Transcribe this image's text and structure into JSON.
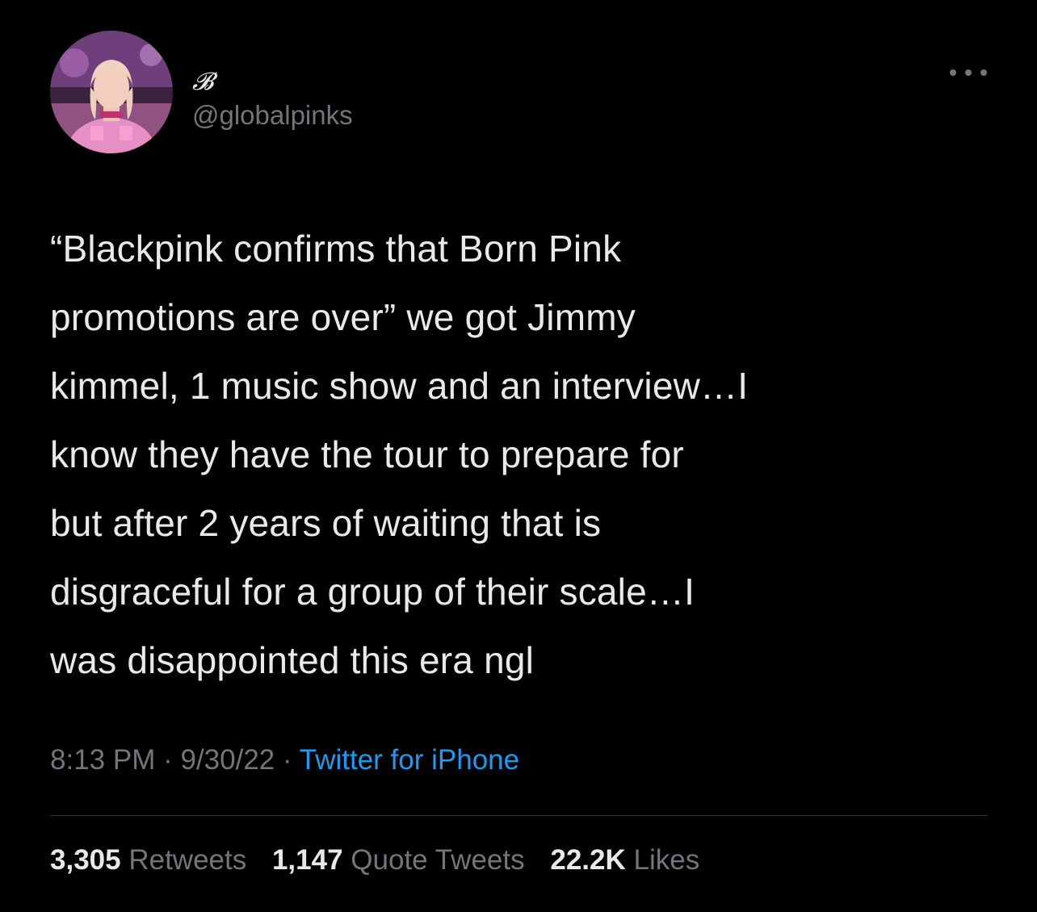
{
  "author": {
    "display_name": "𝓑",
    "handle": "@globalpinks"
  },
  "tweet": {
    "text": "“Blackpink confirms that Born Pink\npromotions are over” we got Jimmy\nkimmel, 1 music show and an interview…I\nknow they have the tour to prepare for\nbut after 2 years of waiting that is\ndisgraceful for a group of their scale…I\nwas disappointed this era ngl",
    "time": "8:13 PM",
    "date": "9/30/22",
    "separator": "·",
    "source": "Twitter for iPhone"
  },
  "stats": {
    "retweets_count": "3,305",
    "retweets_label": "Retweets",
    "quotes_count": "1,147",
    "quotes_label": "Quote Tweets",
    "likes_count": "22.2K",
    "likes_label": "Likes"
  },
  "icons": {
    "more": "more-horizontal-icon"
  },
  "colors": {
    "background": "#000000",
    "text": "#e7e9ea",
    "secondary": "#71767b",
    "link": "#1d9bf0"
  }
}
